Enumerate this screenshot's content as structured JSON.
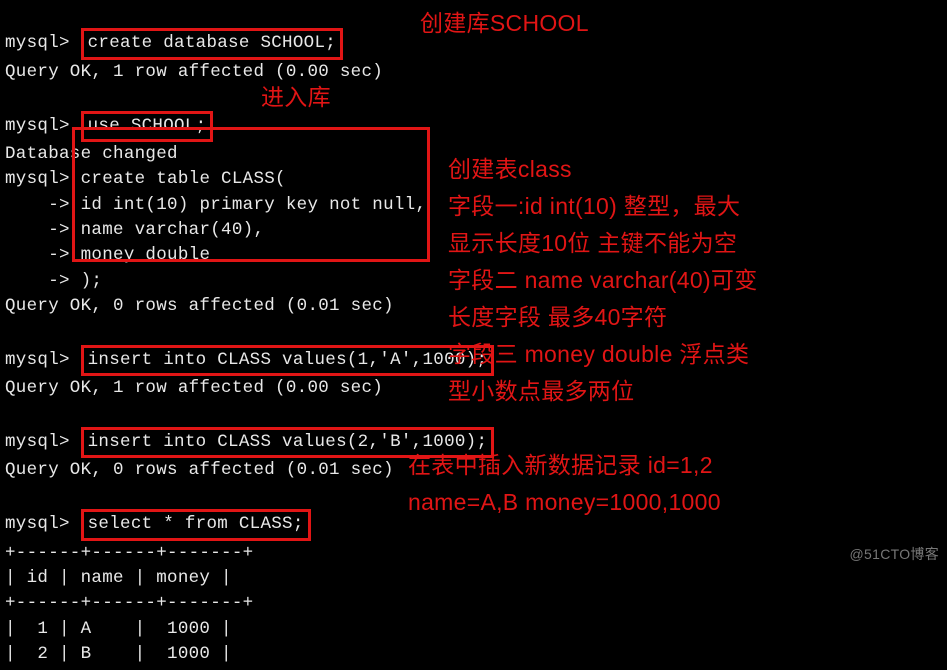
{
  "prompt": "mysql>",
  "cont": "    ->",
  "lines": {
    "1_cmd": "create database SCHOOL;",
    "1_out": "Query OK, 1 row affected (0.00 sec)",
    "2_cmd": "use SCHOOL;",
    "2_out": "Database changed",
    "3_cmd": "create table CLASS(",
    "3a": "id int(10) primary key not null,",
    "3b": "name varchar(40),",
    "3c": "money double",
    "3d": ");",
    "3_out": "Query OK, 0 rows affected (0.01 sec)",
    "4_cmd": "insert into CLASS values(1,'A',1000);",
    "4_out": "Query OK, 1 row affected (0.00 sec)",
    "5_cmd": "insert into CLASS values(2,'B',1000);",
    "5_out": "Query OK, 0 rows affected (0.01 sec)",
    "6_cmd": "select * from CLASS;",
    "tbl_sep": "+------+------+-------+",
    "tbl_hdr": "| id | name | money |",
    "tbl_r1": "|  1 | A    |  1000 |",
    "tbl_r2": "|  2 | B    |  1000 |"
  },
  "ann": {
    "a1": "创建库SCHOOL",
    "a2": "进入库",
    "a3": "创建表class",
    "a4": "字段一:id int(10) 整型，最大",
    "a5": "显示长度10位 主键不能为空",
    "a6": "字段二 name varchar(40)可变",
    "a7": "长度字段 最多40字符",
    "a8": "字段三 money double 浮点类",
    "a9": "型小数点最多两位",
    "a10": "在表中插入新数据记录 id=1,2",
    "a11": "name=A,B     money=1000,1000"
  },
  "chart_data": {
    "type": "table",
    "headers": [
      "id",
      "name",
      "money"
    ],
    "rows": [
      [
        1,
        "A",
        1000
      ],
      [
        2,
        "B",
        1000
      ]
    ]
  },
  "watermark": "@51CTO博客"
}
